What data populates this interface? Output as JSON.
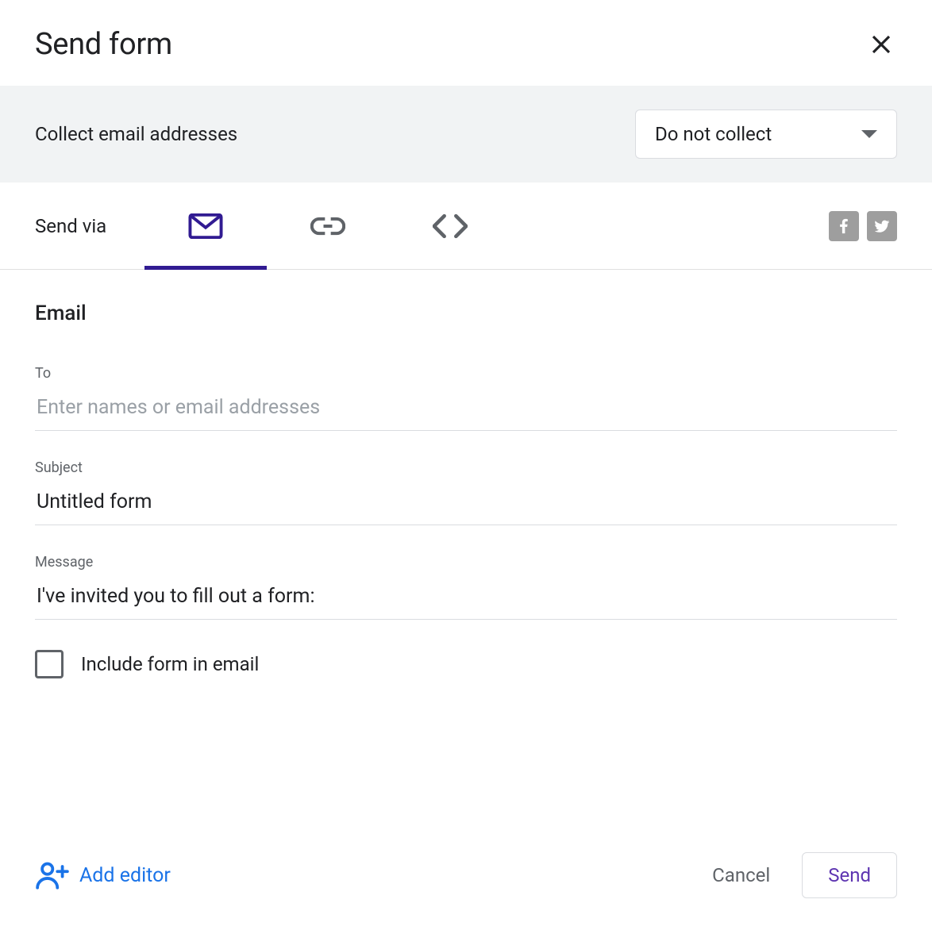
{
  "header": {
    "title": "Send form"
  },
  "collect": {
    "label": "Collect email addresses",
    "selected": "Do not collect"
  },
  "sendvia": {
    "label": "Send via",
    "active_tab": "email"
  },
  "email_section": {
    "title": "Email",
    "to_label": "To",
    "to_placeholder": "Enter names or email addresses",
    "to_value": "",
    "subject_label": "Subject",
    "subject_value": "Untitled form",
    "message_label": "Message",
    "message_value": "I've invited you to fill out a form:",
    "include_checkbox_label": "Include form in email",
    "include_checked": false
  },
  "footer": {
    "add_editor_label": "Add editor",
    "cancel_label": "Cancel",
    "send_label": "Send"
  }
}
